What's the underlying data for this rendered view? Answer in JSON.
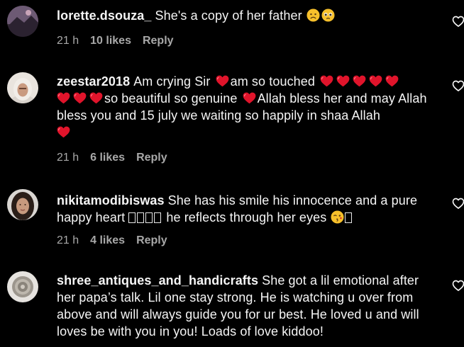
{
  "comments": [
    {
      "username": "lorette.dsouza_",
      "text": "She's a copy of her father",
      "time": "21 h",
      "likes": "10 likes",
      "reply": "Reply",
      "emojis": [
        "sad-face",
        "pleading-face"
      ]
    },
    {
      "username": "zeestar2018",
      "segments": [
        "Am crying Sir",
        "am so touched",
        "so beautiful so genuine",
        "Allah bless her and may Allah bless you and 15 july we waiting so happily in shaa Allah"
      ],
      "time": "21 h",
      "likes": "6 likes",
      "reply": "Reply"
    },
    {
      "username": "nikitamodibiswas",
      "segments": [
        "She has his smile his innocence and a pure happy heart",
        "he reflects through her eyes"
      ],
      "time": "21 h",
      "likes": "4 likes",
      "reply": "Reply",
      "emojis": [
        "kiss-face"
      ]
    },
    {
      "username": "shree_antiques_and_handicrafts",
      "text": "She got a lil emotional after her papa’s talk. Lil one stay strong. He is watching u over from above and will always guide you for ur best. He loved u and will loves be with you in you! Loads of love kiddoo!"
    }
  ],
  "colors": {
    "background": "#000000",
    "text": "#f5f5f5",
    "meta": "#a8a8a8",
    "heart_emoji": "#e0142b"
  },
  "icons": {
    "like": "heart-outline-icon"
  }
}
